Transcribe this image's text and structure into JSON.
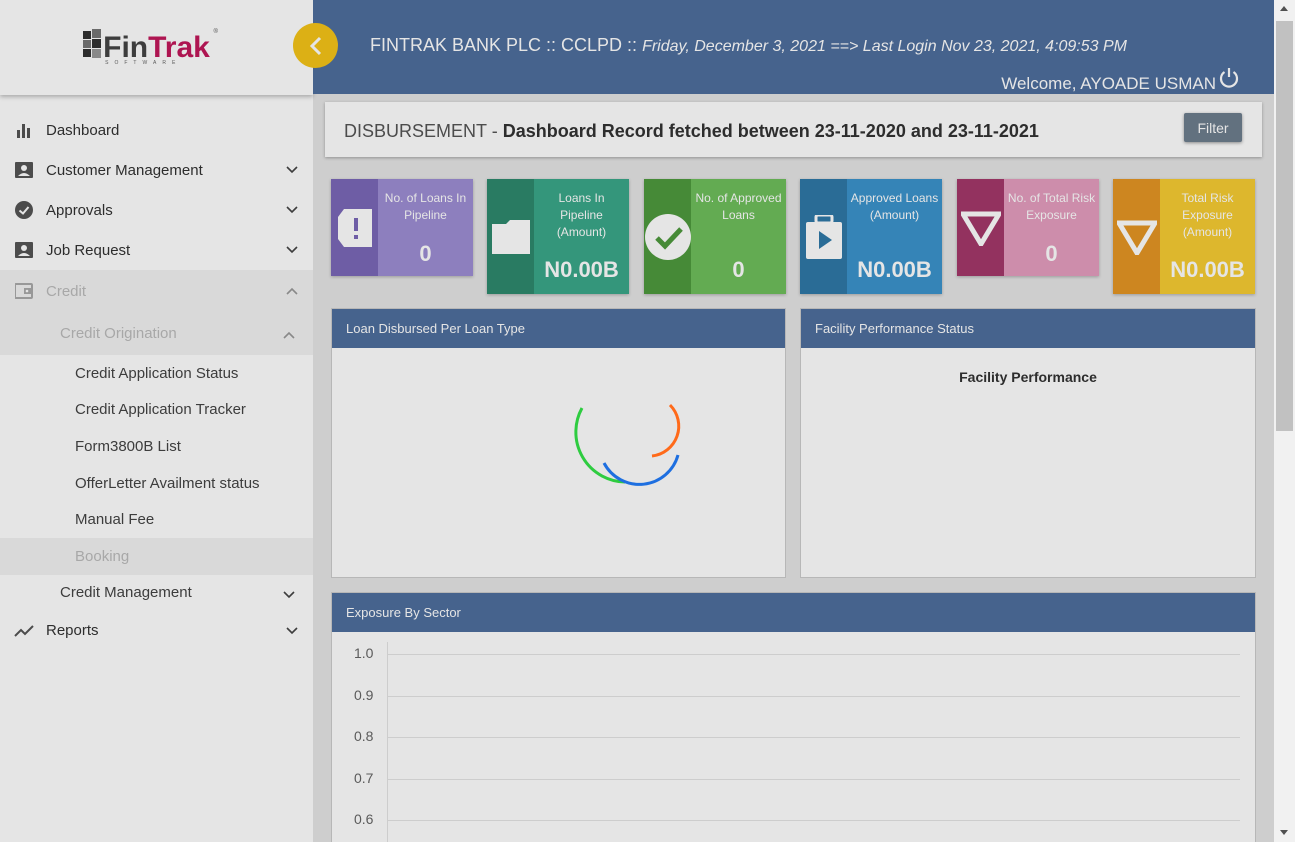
{
  "sidebar": {
    "logo": {
      "fin": "Fin",
      "trak": "Trak",
      "sub": "SOFTWARE",
      "reg": "®"
    },
    "items": [
      {
        "label": "Dashboard",
        "icon": "bar-chart-icon"
      },
      {
        "label": "Customer Management",
        "icon": "contact-card-icon"
      },
      {
        "label": "Approvals",
        "icon": "check-circle-icon"
      },
      {
        "label": "Job Request",
        "icon": "contact-card-icon"
      },
      {
        "label": "Credit",
        "icon": "wallet-icon"
      }
    ],
    "credit_origination": {
      "label": "Credit Origination",
      "items": [
        "Credit Application Status",
        "Credit Application Tracker",
        "Form3800B List",
        "OfferLetter Availment status",
        "Manual Fee",
        "Booking"
      ]
    },
    "credit_management": "Credit Management",
    "reports": {
      "label": "Reports",
      "icon": "trend-line-icon"
    }
  },
  "header": {
    "bank": "FINTRAK BANK PLC :: CCLPD ::",
    "date_info": "Friday, December 3, 2021 ==> Last Login Nov 23, 2021, 4:09:53 PM",
    "welcome": "Welcome, AYOADE USMAN"
  },
  "page": {
    "section": "DISBURSEMENT -",
    "title": "Dashboard Record fetched between 23-11-2020 and 23-11-2021",
    "filter_label": "Filter"
  },
  "cards": [
    {
      "label": "No. of Loans In Pipeline",
      "value": "0",
      "color_left": "#7b68b8",
      "color_right": "#9e8ed4",
      "icon": "ticket-alert-icon"
    },
    {
      "label": "Loans In Pipeline (Amount)",
      "value": "N0.00B",
      "color_left": "#2e8a6e",
      "color_right": "#3aa889",
      "icon": "folder-icon"
    },
    {
      "label": "No. of Approved Loans",
      "value": "0",
      "color_left": "#4e9a3e",
      "color_right": "#6fbf5c",
      "icon": "check-circle-icon"
    },
    {
      "label": "Approved Loans (Amount)",
      "value": "N0.00B",
      "color_left": "#2f79a8",
      "color_right": "#3c93cc",
      "icon": "briefcase-play-icon"
    },
    {
      "label": "No. of Total Risk Exposure",
      "value": "0",
      "color_left": "#a4386a",
      "color_right": "#e59dbf",
      "icon": "triangle-down-icon"
    },
    {
      "label": "Total Risk Exposure (Amount)",
      "value": "N0.00B",
      "color_left": "#e59624",
      "color_right": "#f6cc33",
      "icon": "triangle-down-icon"
    }
  ],
  "panels": {
    "loan_disbursed": "Loan Disbursed Per Loan Type",
    "facility_status": "Facility Performance Status",
    "facility_title": "Facility Performance",
    "exposure": "Exposure By Sector"
  },
  "chart_data": {
    "type": "bar",
    "title": "",
    "categories": [],
    "values": [],
    "ylim": [
      0.6,
      1.0
    ],
    "yticks": [
      "1.0",
      "0.9",
      "0.8",
      "0.7",
      "0.6"
    ],
    "grid": true
  }
}
